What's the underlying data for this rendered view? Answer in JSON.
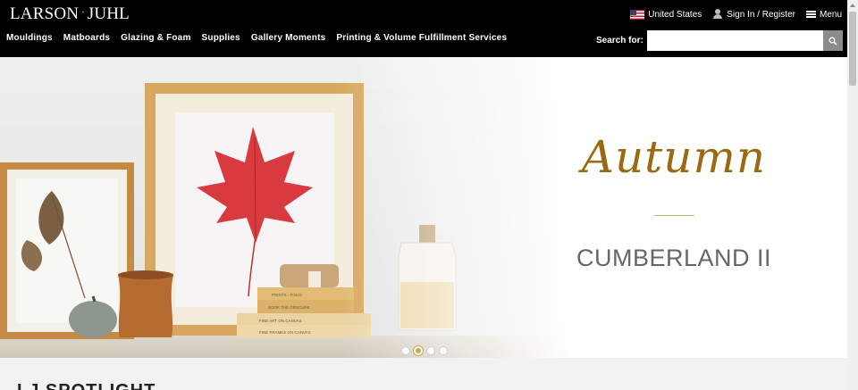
{
  "header": {
    "logo": {
      "left": "LARSON",
      "sep": "·",
      "right": "JUHL"
    },
    "utility": {
      "country": "United States",
      "account": "Sign In / Register",
      "menu": "Menu"
    },
    "nav": [
      "Mouldings",
      "Matboards",
      "Glazing & Foam",
      "Supplies",
      "Gallery Moments",
      "Printing & Volume Fulfillment Services"
    ],
    "search": {
      "label": "Search for:",
      "value": "",
      "placeholder": ""
    }
  },
  "hero": {
    "script_title": "Autumn",
    "collection": "CUMBERLAND II",
    "slides": 4,
    "active_slide": 2,
    "colors": {
      "script": "#9b6a10",
      "divider": "#c8b27b",
      "collection": "#666666"
    },
    "book_spines": [
      "PRINTS · FOLIO",
      "BOOK THE OBSCURE",
      "FINE ART ON CANVAS",
      "FINE FRAMES ON CANVAS"
    ]
  },
  "spotlight": {
    "heading": "LJ SPOTLIGHT"
  },
  "icons": [
    "us-flag-icon",
    "person-icon",
    "hamburger-menu-icon",
    "search-icon"
  ]
}
